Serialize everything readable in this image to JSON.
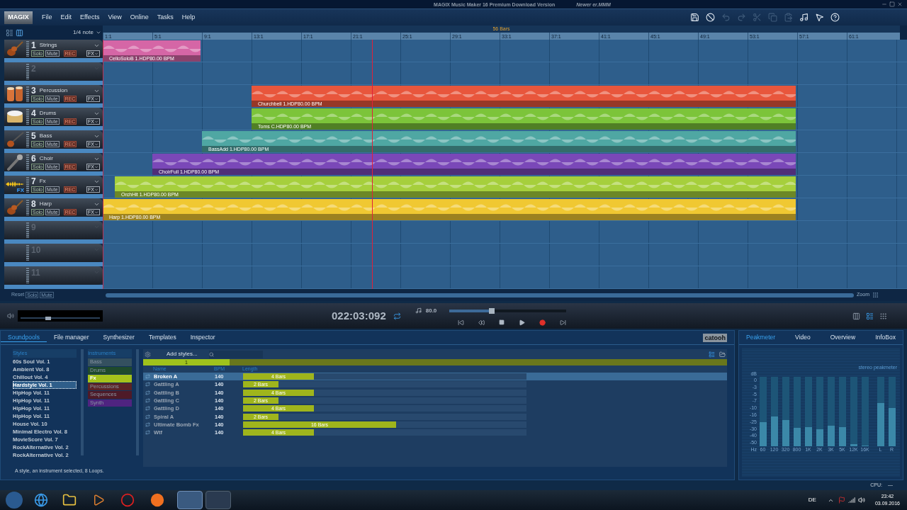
{
  "window": {
    "title": "MAGIX Music Maker 16 Premium Download Version",
    "document": "Newer er.MMM"
  },
  "logo": "MAGIX",
  "menu": [
    "File",
    "Edit",
    "Effects",
    "View",
    "Online",
    "Tasks",
    "Help"
  ],
  "toolbar": [
    {
      "disabled": false
    },
    {
      "disabled": false
    },
    {
      "disabled": true
    },
    {
      "disabled": true
    },
    {
      "disabled": true
    },
    {
      "disabled": true
    },
    {
      "disabled": true
    },
    {
      "disabled": false
    },
    {
      "disabled": false
    },
    {
      "disabled": false
    }
  ],
  "snap": "1/4 note",
  "ruler": {
    "length": "56 Bars",
    "marks": [
      "1:1",
      "5:1",
      "9:1",
      "13:1",
      "17:1",
      "21:1",
      "25:1",
      "29:1",
      "33:1",
      "37:1",
      "41:1",
      "45:1",
      "49:1",
      "53:1",
      "57:1",
      "61:1"
    ]
  },
  "tracks": [
    {
      "number": "1",
      "name": "Strings",
      "kind": "instrument",
      "solo": "Solo",
      "mute": "Mute",
      "rec": "REC",
      "fx": "FX",
      "clip": {
        "label": "CelloSoloB 1.HDP80.00 BPM",
        "color": "#d566a6"
      }
    },
    {
      "number": "2",
      "kind": "empty"
    },
    {
      "number": "3",
      "name": "Percussion",
      "kind": "instrument",
      "solo": "Solo",
      "mute": "Mute",
      "rec": "REC",
      "fx": "FX",
      "clip": {
        "label": "Churchbell 1.HDP80.00 BPM",
        "color": "#e8563c"
      }
    },
    {
      "number": "4",
      "name": "Drums",
      "kind": "instrument",
      "solo": "Solo",
      "mute": "Mute",
      "rec": "REC",
      "fx": "FX",
      "clip": {
        "label": "Toms C.HDP80.00 BPM",
        "color": "#7cc43a"
      }
    },
    {
      "number": "5",
      "name": "Bass",
      "kind": "instrument",
      "solo": "Solo",
      "mute": "Mute",
      "rec": "REC",
      "fx": "FX",
      "clip": {
        "label": "BassAdd 1.HDP80.00 BPM",
        "color": "#4fa7a3"
      }
    },
    {
      "number": "6",
      "name": "Choir",
      "kind": "instrument",
      "solo": "Solo",
      "mute": "Mute",
      "rec": "REC",
      "fx": "FX",
      "clip": {
        "label": "ChoirFull 1.HDP80.00 BPM",
        "color": "#7a48b8"
      }
    },
    {
      "number": "7",
      "name": "Fx",
      "kind": "instrument",
      "icon_label": "FX",
      "solo": "Solo",
      "mute": "Mute",
      "rec": "REC",
      "fx": "FX",
      "clip": {
        "label": "OrchHit 1.HDP80.00 BPM",
        "color": "#a6cf3c"
      }
    },
    {
      "number": "8",
      "name": "Harp",
      "kind": "instrument",
      "solo": "Solo",
      "mute": "Mute",
      "rec": "REC",
      "fx": "FX",
      "clip": {
        "label": "Harp 1.HDP80.00 BPM",
        "color": "#f0c832"
      }
    },
    {
      "number": "9",
      "kind": "empty"
    },
    {
      "number": "10",
      "kind": "empty"
    },
    {
      "number": "11",
      "kind": "empty"
    }
  ],
  "arranger_footer": {
    "reset": "Reset",
    "solo": "Solo",
    "mute": "Mute",
    "zoom": "Zoom"
  },
  "transport": {
    "time": "022:03:092",
    "tempo": "80.0",
    "volume": {
      "level": 0.35
    },
    "position": {
      "level": 0.34
    }
  },
  "browser_tabs": [
    {
      "label": "Soundpools",
      "selected": true
    },
    {
      "label": "File manager",
      "selected": false
    },
    {
      "label": "Synthesizer",
      "selected": false
    },
    {
      "label": "Templates",
      "selected": false
    },
    {
      "label": "Inspector",
      "selected": false
    }
  ],
  "brand": "catooh",
  "styles": {
    "heading": "Styles",
    "items": [
      {
        "label": "60s Soul Vol. 1",
        "selected": false
      },
      {
        "label": "Ambient Vol. 8",
        "selected": false
      },
      {
        "label": "Chillout Vol. 4",
        "selected": false
      },
      {
        "label": "Hardstyle Vol. 1",
        "selected": true
      },
      {
        "label": "HipHop Vol. 11",
        "selected": false
      },
      {
        "label": "HipHop Vol. 11",
        "selected": false
      },
      {
        "label": "HipHop Vol. 11",
        "selected": false
      },
      {
        "label": "HipHop Vol. 11",
        "selected": false
      },
      {
        "label": "House Vol. 10",
        "selected": false
      },
      {
        "label": "Minimal Electro Vol. 8",
        "selected": false
      },
      {
        "label": "MovieScore Vol. 7",
        "selected": false
      },
      {
        "label": "RockAlternative Vol. 2",
        "selected": false
      },
      {
        "label": "RockAlternative Vol. 2",
        "selected": false
      }
    ]
  },
  "instruments": {
    "heading": "Instruments",
    "items": [
      {
        "label": "Bass",
        "selected": false,
        "color": "#34505f"
      },
      {
        "label": "Drums",
        "selected": false,
        "color": "#1f4a2c"
      },
      {
        "label": "Fx",
        "selected": true,
        "color": "#a5c21c"
      },
      {
        "label": "Percussions",
        "selected": false,
        "color": "#5c2326"
      },
      {
        "label": "Sequences",
        "selected": false,
        "color": "#4e1a28"
      },
      {
        "label": "Synth",
        "selected": false,
        "color": "#4f2480"
      }
    ]
  },
  "loops": {
    "add_styles": "Add styles...",
    "page": "1",
    "columns": [
      "Name",
      "BPM",
      "Length"
    ],
    "rows": [
      {
        "name": "Broken A",
        "bpm": "140",
        "length": "4 Bars",
        "level": 0.25,
        "selected": true
      },
      {
        "name": "Gattling A",
        "bpm": "140",
        "length": "2 Bars",
        "level": 0.125,
        "selected": false
      },
      {
        "name": "Gattling B",
        "bpm": "140",
        "length": "4 Bars",
        "level": 0.25,
        "selected": false
      },
      {
        "name": "Gattling C",
        "bpm": "140",
        "length": "2 Bars",
        "level": 0.125,
        "selected": false
      },
      {
        "name": "Gattling D",
        "bpm": "140",
        "length": "4 Bars",
        "level": 0.25,
        "selected": false
      },
      {
        "name": "Spiral A",
        "bpm": "140",
        "length": "2 Bars",
        "level": 0.125,
        "selected": false
      },
      {
        "name": "Ultimate Bomb Fx",
        "bpm": "140",
        "length": "16 Bars",
        "level": 0.54,
        "selected": false
      },
      {
        "name": "Wtf",
        "bpm": "140",
        "length": "4 Bars",
        "level": 0.25,
        "selected": false
      }
    ]
  },
  "status": "A style, an instrument selected, 8 Loops.",
  "side_tabs": [
    {
      "label": "Peakmeter",
      "selected": true
    },
    {
      "label": "Video",
      "selected": false
    },
    {
      "label": "Overview",
      "selected": false
    },
    {
      "label": "InfoBox",
      "selected": false
    }
  ],
  "peakmeter": {
    "title": "stereo peakmeter",
    "unit": "dB",
    "scale": [
      "0",
      "-3",
      "-5",
      "-7",
      "-10",
      "-16",
      "-25",
      "-30",
      "-40",
      "-50"
    ],
    "axis_label": "Hz",
    "bands": [
      {
        "label": "60",
        "level": 0.35
      },
      {
        "label": "120",
        "level": 0.43
      },
      {
        "label": "320",
        "level": 0.38
      },
      {
        "label": "800",
        "level": 0.27
      },
      {
        "label": "1K",
        "level": 0.28
      },
      {
        "label": "2K",
        "level": 0.24
      },
      {
        "label": "3K",
        "level": 0.3
      },
      {
        "label": "5K",
        "level": 0.28
      },
      {
        "label": "12K",
        "level": 0.03
      },
      {
        "label": "16K",
        "level": 0.01
      },
      {
        "label": "L",
        "level": 0.62
      },
      {
        "label": "R",
        "level": 0.55
      }
    ]
  },
  "cpu": {
    "label": "CPU:",
    "value": "—"
  },
  "taskbar": {
    "language": "DE",
    "time": "23:42",
    "date": "03.09.2016"
  }
}
